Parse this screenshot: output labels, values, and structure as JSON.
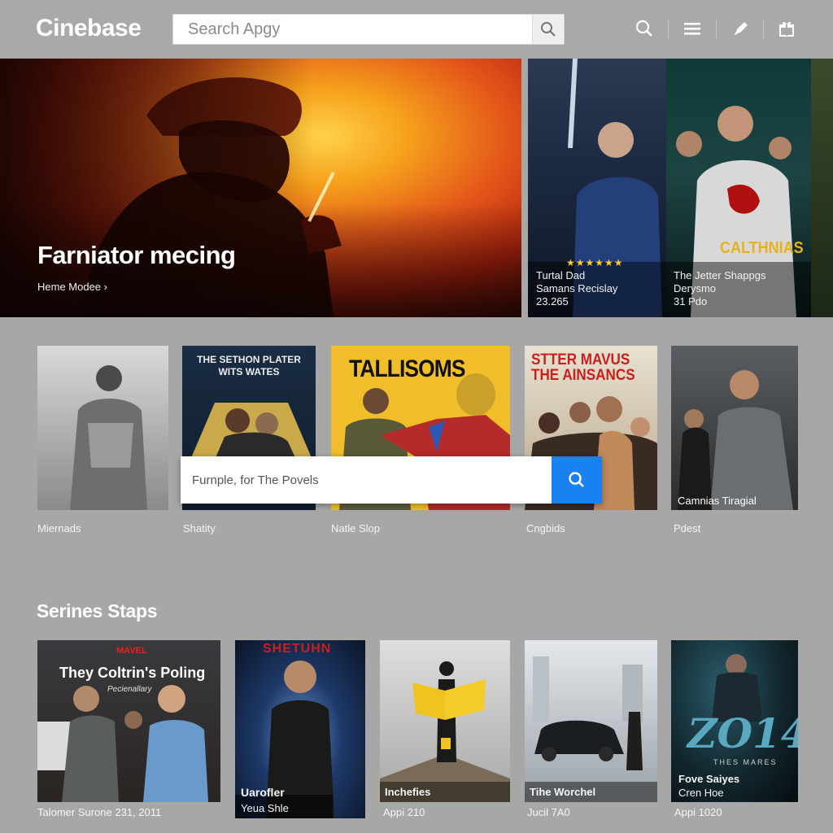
{
  "app": {
    "logo": "Cinebase"
  },
  "search": {
    "placeholder": "Search Apgy"
  },
  "nav_icons": [
    "search-icon",
    "menu-icon",
    "edit-icon",
    "gift-icon"
  ],
  "hero": {
    "title": "Farniator mecing",
    "link": "Heme Modee ›",
    "side_cards": [
      {
        "line1": "Turtal Dad",
        "line2": "Samans Recislay",
        "line3": "23.265",
        "rating_stars": "★★★★★★"
      },
      {
        "line1": "The Jetter Shappgs",
        "line2": "Derysmo",
        "line3": "31 Pdo",
        "poster_text": "CALTHNIAS"
      }
    ]
  },
  "row1": {
    "posters": [
      {
        "caption": "Miernads"
      },
      {
        "caption": "Shatity",
        "poster_text": "THE SETHON PLATER WITS WATES"
      },
      {
        "caption": "Natle Slop",
        "poster_text": "TALLISOMS"
      },
      {
        "caption": "Cngbids",
        "poster_text": "STTER MAVUS THE AINSANCS"
      },
      {
        "caption": "Pdest",
        "overlay": "Camnias Tiragial"
      }
    ]
  },
  "overlay_search": {
    "placeholder": "Furnple, for The Povels"
  },
  "section": {
    "title": "Serines Staps"
  },
  "row2": {
    "posters": [
      {
        "brand": "MAVEL",
        "title": "They Coltrin's Poling",
        "sub": "Pecienallary",
        "caption": "Talomer Surone 231, 2011"
      },
      {
        "top": "SHETUHN",
        "overlay1": "Uarofler",
        "overlay2": "Yeua Shle"
      },
      {
        "overlay1": "Inchefies",
        "caption": "Appi 210"
      },
      {
        "overlay1": "Tihe Worchel",
        "caption": "Jucil 7A0"
      },
      {
        "big": "ZO14",
        "sub": "THES MARES",
        "overlay1": "Fove Saiyes",
        "overlay2": "Cren Hoe",
        "caption": "Appi 1020"
      }
    ]
  }
}
